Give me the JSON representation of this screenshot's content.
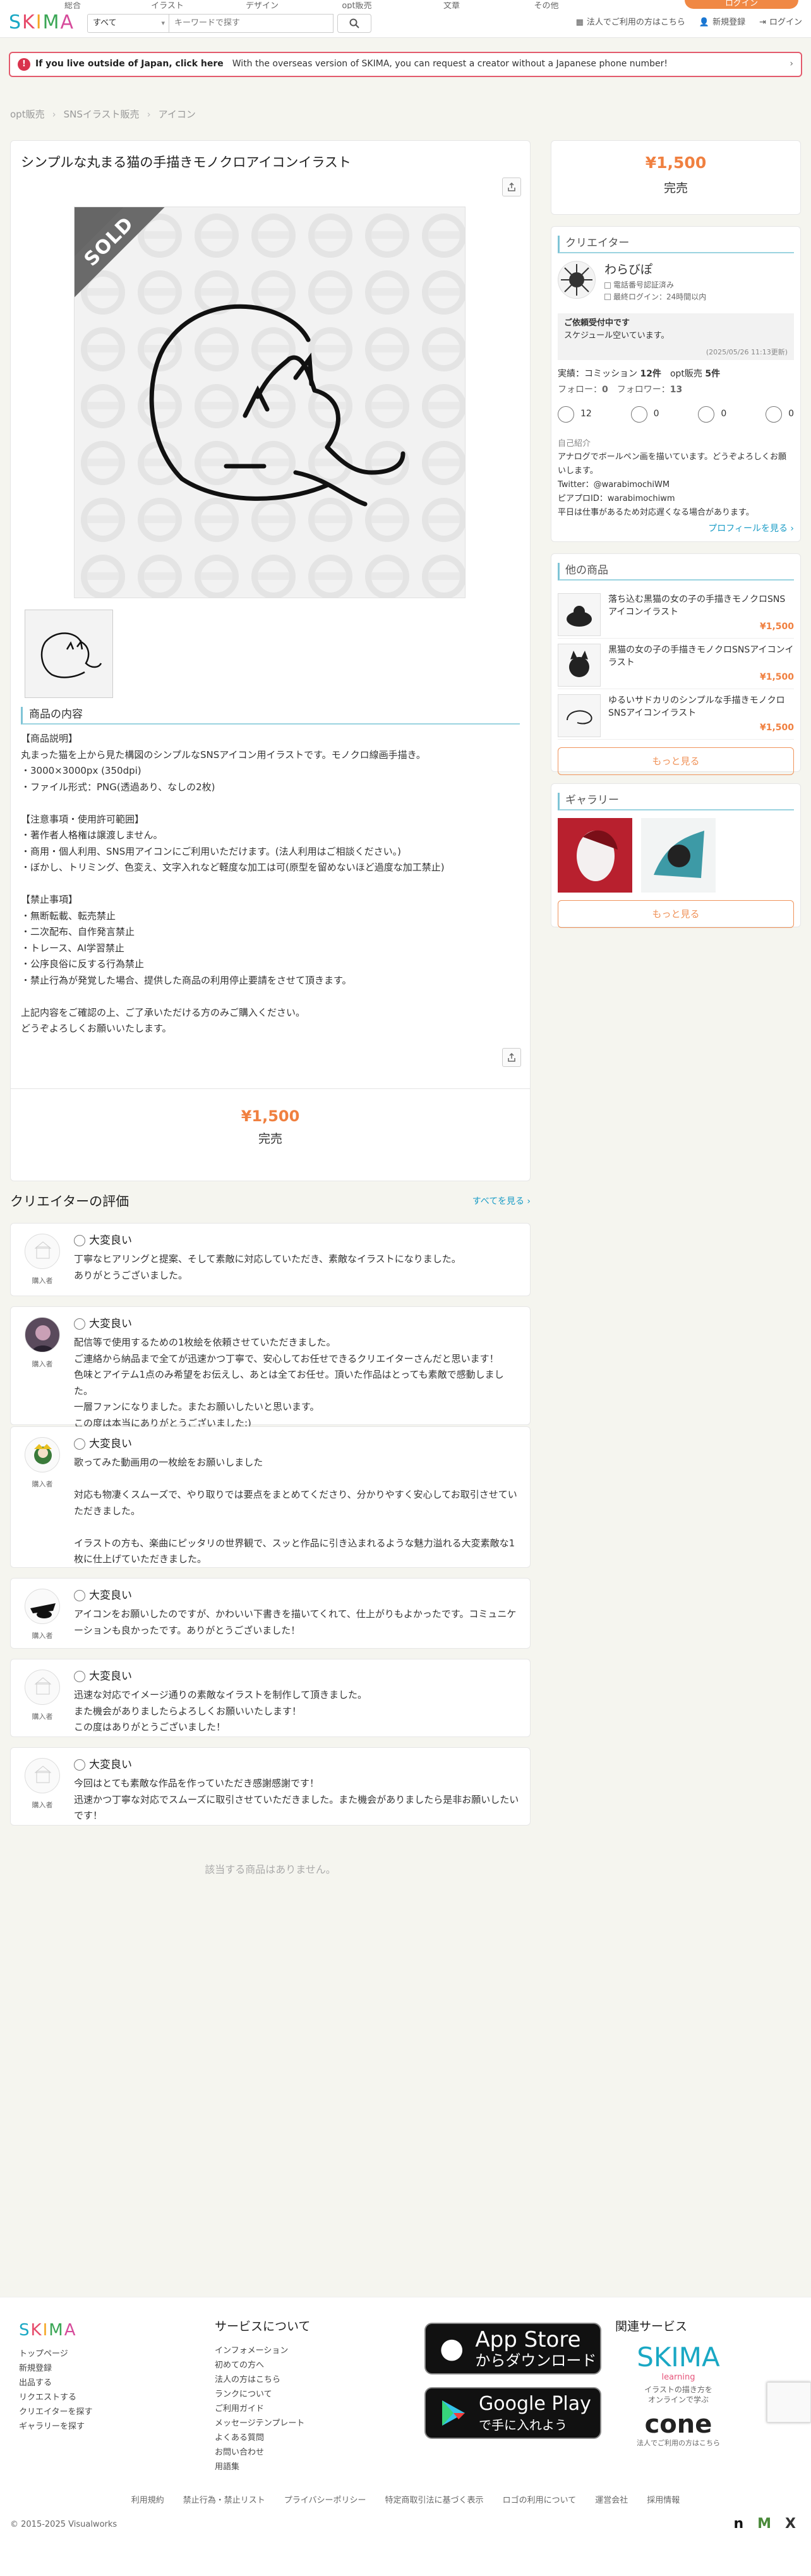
{
  "topnav": {
    "items": [
      "総合",
      "イラスト",
      "デザイン",
      "opt販売",
      "文章",
      "その他"
    ],
    "signup": "ログイン"
  },
  "header": {
    "logo": "SKIMA",
    "category": "すべて",
    "search_placeholder": "キーワードで探す",
    "links": [
      "法人でご利用の方はこちら",
      "新規登録",
      "ログイン"
    ]
  },
  "banner": {
    "title": "If you live outside of Japan, click here",
    "text": "With the overseas version of SKIMA, you can request a creator without a Japanese phone number!"
  },
  "breadcrumb": [
    "opt販売",
    "SNSイラスト販売",
    "アイコン"
  ],
  "product": {
    "title": "シンプルな丸まる猫の手描きモノクロアイコンイラスト",
    "sold_label": "SOLD",
    "section_title": "商品の内容",
    "description": "【商品説明】\n丸まった猫を上から見た構図のシンプルなSNSアイコン用イラストです。モノクロ線画手描き。\n・3000×3000px (350dpi)\n・ファイル形式：PNG(透過あり、なしの2枚)\n\n【注意事項・使用許可範囲】\n・著作者人格権は譲渡しません。\n・商用・個人利用、SNS用アイコンにご利用いただけます。(法人利用はご相談ください。)\n・ぼかし、トリミング、色変え、文字入れなど軽度な加工は可(原型を留めないほど過度な加工禁止)\n\n【禁止事項】\n・無断転載、転売禁止\n・二次配布、自作発言禁止\n・トレース、AI学習禁止\n・公序良俗に反する行為禁止\n・禁止行為が発覚した場合、提供した商品の利用停止要請をさせて頂きます。\n\n上記内容をご確認の上、ご了承いただける方のみご購入ください。\nどうぞよろしくお願いいたします。",
    "price": "¥1,500",
    "status": "完売"
  },
  "side": {
    "price": "¥1,500",
    "status": "完売",
    "creator_heading": "クリエイター",
    "creator_name": "わらびぽ",
    "badges": [
      "電話番号認証済み",
      "最終ログイン：24時間以内"
    ],
    "accept_title": "ご依頼受付中です",
    "accept_text": "スケジュール空いています。",
    "accept_date": "(2025/05/26 11:13更新)",
    "stats": {
      "commission_label": "実績：コミッション",
      "commission": "12件",
      "opt_label": "opt販売",
      "opt": "5件"
    },
    "follow": {
      "follow_label": "フォロー：",
      "follow": "0",
      "follower_label": "フォロワー：",
      "follower": "13"
    },
    "faces": [
      "12",
      "0",
      "0",
      "0"
    ],
    "bio_heading": "自己紹介",
    "bio": "アナログでボールペン画を描いています。どうぞよろしくお願いします。\nTwitter：@warabimochiWM\nピアプロID：warabimochiwm\n平日は仕事があるため対応遅くなる場合があります。",
    "profile_link": "プロフィールを見る ›",
    "other_heading": "他の商品",
    "other_items": [
      {
        "title": "落ち込む黒猫の女の子の手描きモノクロSNSアイコンイラスト",
        "price": "¥1,500"
      },
      {
        "title": "黒猫の女の子の手描きモノクロSNSアイコンイラスト",
        "price": "¥1,500"
      },
      {
        "title": "ゆるいサドカリのシンプルな手描きモノクロSNSアイコンイラスト",
        "price": "¥1,500"
      }
    ],
    "more_label": "もっと見る",
    "gallery_heading": "ギャラリー",
    "gallery_more": "もっと見る"
  },
  "reviews": {
    "heading": "クリエイターの評価",
    "see_all": "すべてを見る ›",
    "items": [
      {
        "rating": "大変良い",
        "kind": "購入者",
        "text": "丁寧なヒアリングと提案、そして素敵に対応していただき、素敵なイラストになりました。\nありがとうございました。"
      },
      {
        "rating": "大変良い",
        "kind": "購入者",
        "text": "配信等で使用するための1枚絵を依頼させていただきました。\nご連絡から納品まで全てが迅速かつ丁寧で、安心してお任せできるクリエイターさんだと思います！\n色味とアイテム1点のみ希望をお伝えし、あとは全てお任せ。頂いた作品はとっても素敵で感動しました。\n一層ファンになりました。またお願いしたいと思います。\nこの度は本当にありがとうございました:)"
      },
      {
        "rating": "大変良い",
        "kind": "購入者",
        "text": "歌ってみた動画用の一枚絵をお願いしました\n\n対応も物凄くスムーズで、やり取りでは要点をまとめてくださり、分かりやすく安心してお取引させていただきました。\n\nイラストの方も、楽曲にピッタリの世界観で、スッと作品に引き込まれるような魅力溢れる大変素敵な1枚に仕上げていただきました。"
      },
      {
        "rating": "大変良い",
        "kind": "購入者",
        "text": "アイコンをお願いしたのですが、かわいい下書きを描いてくれて、仕上がりもよかったです。コミュニケーションも良かったです。ありがとうございました！"
      },
      {
        "rating": "大変良い",
        "kind": "購入者",
        "text": "迅速な対応でイメージ通りの素敵なイラストを制作して頂きました。\nまた機会がありましたらよろしくお願いいたします！\nこの度はありがとうございました！"
      },
      {
        "rating": "大変良い",
        "kind": "購入者",
        "text": "今回はとても素敵な作品を作っていただき感謝感謝です！\n迅速かつ丁寧な対応でスムーズに取引させていただきました。また機会がありましたら是非お願いしたいです！"
      }
    ],
    "empty": "該当する商品はありません。"
  },
  "footer": {
    "col1": [
      "トップページ",
      "新規登録",
      "出品する",
      "リクエストする",
      "クリエイターを探す",
      "ギャラリーを探す"
    ],
    "col2_heading": "サービスについて",
    "col2": [
      "インフォメーション",
      "初めての方へ",
      "法人の方はこちら",
      "ランクについて",
      "ご利用ガイド",
      "メッセージテンプレート",
      "よくある質問",
      "お問い合わせ",
      "用語集"
    ],
    "appstore": [
      "App Store",
      "からダウンロード"
    ],
    "googleplay": [
      "Google Play",
      "で手に入れよう"
    ],
    "related_heading": "関連サービス",
    "skima_learning": "SKIMA",
    "learning_sub": "learning",
    "learning_desc": "イラストの描き方を\nオンラインで学ぶ",
    "cone": "cone",
    "cone_desc": "法人でご利用の方はこちら",
    "links": [
      "利用規約",
      "禁止行為・禁止リスト",
      "プライバシーポリシー",
      "特定商取引法に基づく表示",
      "ロゴの利用について",
      "運営会社",
      "採用情報"
    ],
    "copyright": "© 2015-2025 Visualworks",
    "social": [
      "n",
      "M",
      "X"
    ]
  }
}
